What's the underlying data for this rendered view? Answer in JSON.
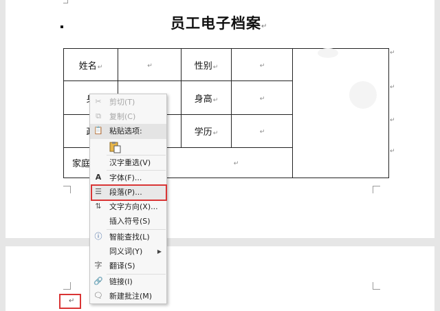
{
  "document": {
    "title": "员工电子档案",
    "paragraph_mark": "↵",
    "table": {
      "row1": {
        "name_label": "姓名",
        "gender_label": "性别"
      },
      "row2": {
        "label1_partial": "身",
        "height_label": "身高"
      },
      "row3": {
        "label1_partial": "政",
        "education_label": "学历"
      },
      "row4": {
        "label1_partial": "家庭"
      }
    }
  },
  "context_menu": {
    "cut": "剪切(T)",
    "copy": "复制(C)",
    "paste_options": "粘贴选项:",
    "reconvert": "汉字重选(V)",
    "font": "字体(F)...",
    "paragraph": "段落(P)...",
    "text_direction": "文字方向(X)...",
    "insert_symbol": "插入符号(S)",
    "smart_lookup": "智能查找(L)",
    "synonyms": "同义词(Y)",
    "translate": "翻译(S)",
    "link": "链接(I)",
    "new_comment": "新建批注(M)"
  },
  "colors": {
    "highlight_border": "#d93434",
    "page_bg": "#ffffff",
    "canvas_bg": "#e6e6e6"
  }
}
